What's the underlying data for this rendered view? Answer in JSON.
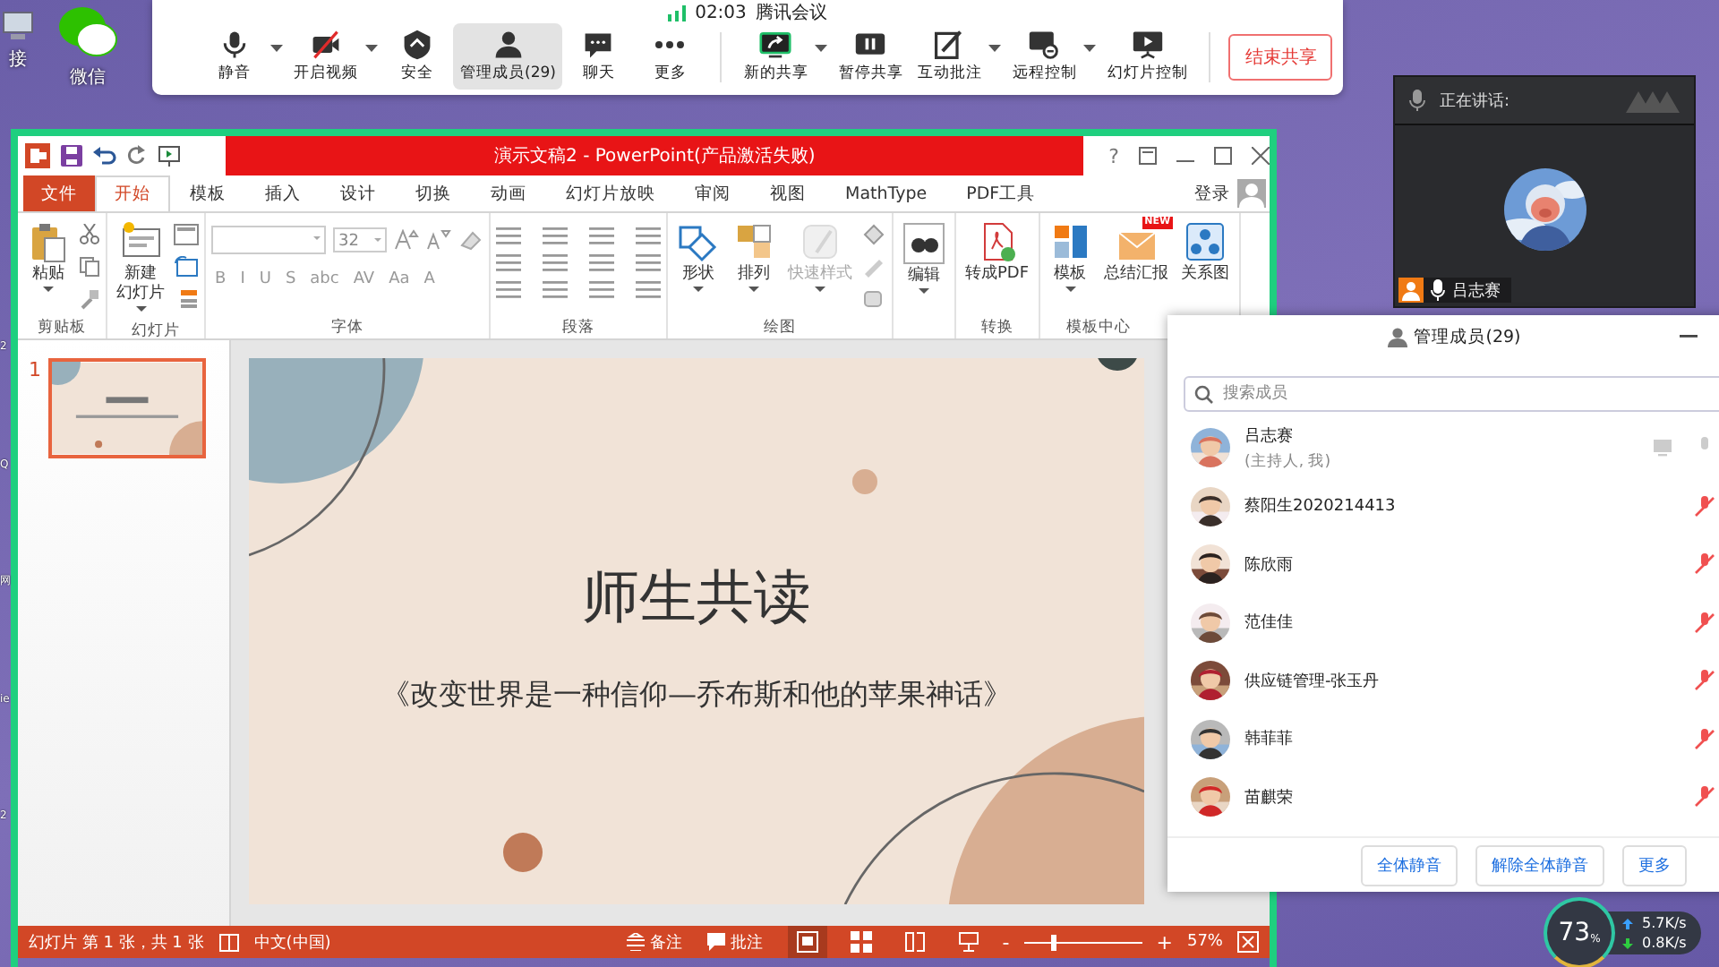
{
  "desktop": {
    "icons": [
      {
        "label": "接"
      },
      {
        "label": "微信"
      }
    ],
    "edge_labels": [
      "2",
      "Q",
      "网",
      "ie",
      "2"
    ]
  },
  "meeting_toolbar": {
    "time": "02:03",
    "title": "腾讯会议",
    "controls": [
      {
        "label": "静音",
        "dropdown": true,
        "selected": false
      },
      {
        "label": "开启视频",
        "dropdown": true,
        "selected": false
      },
      {
        "label": "安全",
        "dropdown": false,
        "selected": false
      },
      {
        "label": "管理成员(29)",
        "dropdown": false,
        "selected": true
      },
      {
        "label": "聊天",
        "dropdown": false,
        "selected": false
      },
      {
        "label": "更多",
        "dropdown": false,
        "selected": false
      }
    ],
    "share_tools": [
      {
        "label": "新的共享",
        "dropdown": true
      },
      {
        "label": "暂停共享",
        "dropdown": false
      },
      {
        "label": "互动批注",
        "dropdown": true
      },
      {
        "label": "远程控制",
        "dropdown": true
      },
      {
        "label": "幻灯片控制",
        "dropdown": false
      }
    ],
    "end_button": "结束共享"
  },
  "speaker_panel": {
    "label": "正在讲话:",
    "speaker": "吕志赛"
  },
  "powerpoint": {
    "title": "演示文稿2 - PowerPoint(产品激活失败)",
    "help": "?",
    "file_tab": "文件",
    "tabs": [
      {
        "label": "开始",
        "selected": true
      },
      {
        "label": "模板",
        "selected": false
      },
      {
        "label": "插入",
        "selected": false
      },
      {
        "label": "设计",
        "selected": false
      },
      {
        "label": "切换",
        "selected": false
      },
      {
        "label": "动画",
        "selected": false
      },
      {
        "label": "幻灯片放映",
        "selected": false
      },
      {
        "label": "审阅",
        "selected": false
      },
      {
        "label": "视图",
        "selected": false
      },
      {
        "label": "MathType",
        "selected": false
      },
      {
        "label": "PDF工具",
        "selected": false
      }
    ],
    "sign_in": "登录",
    "ribbon_groups": [
      {
        "kind": "clipboard",
        "label": "剪贴板",
        "buttons": [
          {
            "label": "粘贴",
            "dropdown": true,
            "disabled": false
          }
        ]
      },
      {
        "kind": "slides",
        "label": "幻灯片",
        "buttons": [
          {
            "label": "新建",
            "label_2": "幻灯片",
            "dropdown": true,
            "disabled": false
          }
        ]
      },
      {
        "kind": "font",
        "label": "字体",
        "font_size": "32",
        "tools": [
          "B",
          "I",
          "U",
          "S",
          "abc",
          "AV",
          "Aa",
          "A"
        ]
      },
      {
        "kind": "paragraph",
        "label": "段落"
      },
      {
        "kind": "drawing",
        "label": "绘图",
        "buttons": [
          {
            "label": "形状",
            "dropdown": true,
            "disabled": false
          },
          {
            "label": "排列",
            "dropdown": true,
            "disabled": false
          },
          {
            "label": "快速样式",
            "dropdown": true,
            "disabled": true
          }
        ]
      },
      {
        "kind": "editing",
        "buttons": [
          {
            "label": "编辑",
            "dropdown": true,
            "disabled": false
          }
        ]
      },
      {
        "kind": "convert",
        "label": "转换",
        "buttons": [
          {
            "label": "转成PDF",
            "dropdown": false,
            "disabled": false
          }
        ]
      },
      {
        "kind": "templates",
        "label": "模板中心",
        "buttons": [
          {
            "label": "模板",
            "dropdown": true,
            "disabled": false
          },
          {
            "label": "总结汇报",
            "dropdown": false,
            "disabled": false,
            "badge": "NEW"
          },
          {
            "label": "关系图",
            "dropdown": false,
            "disabled": false
          }
        ]
      }
    ],
    "thumbnail": {
      "number": "1",
      "selected": true
    },
    "slide": {
      "title": "师生共读",
      "subtitle": "《改变世界是一种信仰—乔布斯和他的苹果神话》"
    },
    "status_bar": {
      "slide_info": "幻灯片 第 1 张，共 1 张",
      "language": "中文(中国)",
      "notes": "备注",
      "comments": "批注",
      "views": [
        {
          "selected": true
        },
        {
          "selected": false
        },
        {
          "selected": false
        },
        {
          "selected": false
        }
      ],
      "zoom_out": "-",
      "zoom_in": "+",
      "zoom": {
        "level": 0.25
      },
      "zoom_text": "57%"
    }
  },
  "member_panel": {
    "title": "管理成员(29)",
    "search_placeholder": "搜索成员",
    "members": [
      {
        "name": "吕志赛",
        "role": "(主持人, 我)",
        "muted": false
      },
      {
        "name": "蔡阳生2020214413",
        "muted": true
      },
      {
        "name": "陈欣雨",
        "muted": true
      },
      {
        "name": "范佳佳",
        "muted": true
      },
      {
        "name": "供应链管理-张玉丹",
        "muted": true
      },
      {
        "name": "韩菲菲",
        "muted": true
      },
      {
        "name": "苗麒荣",
        "muted": true
      }
    ],
    "buttons": [
      "全体静音",
      "解除全体静音",
      "更多"
    ]
  },
  "network_widget": {
    "cpu": "73",
    "unit": "%",
    "upload": "5.7K/s",
    "download": "0.8K/s"
  }
}
